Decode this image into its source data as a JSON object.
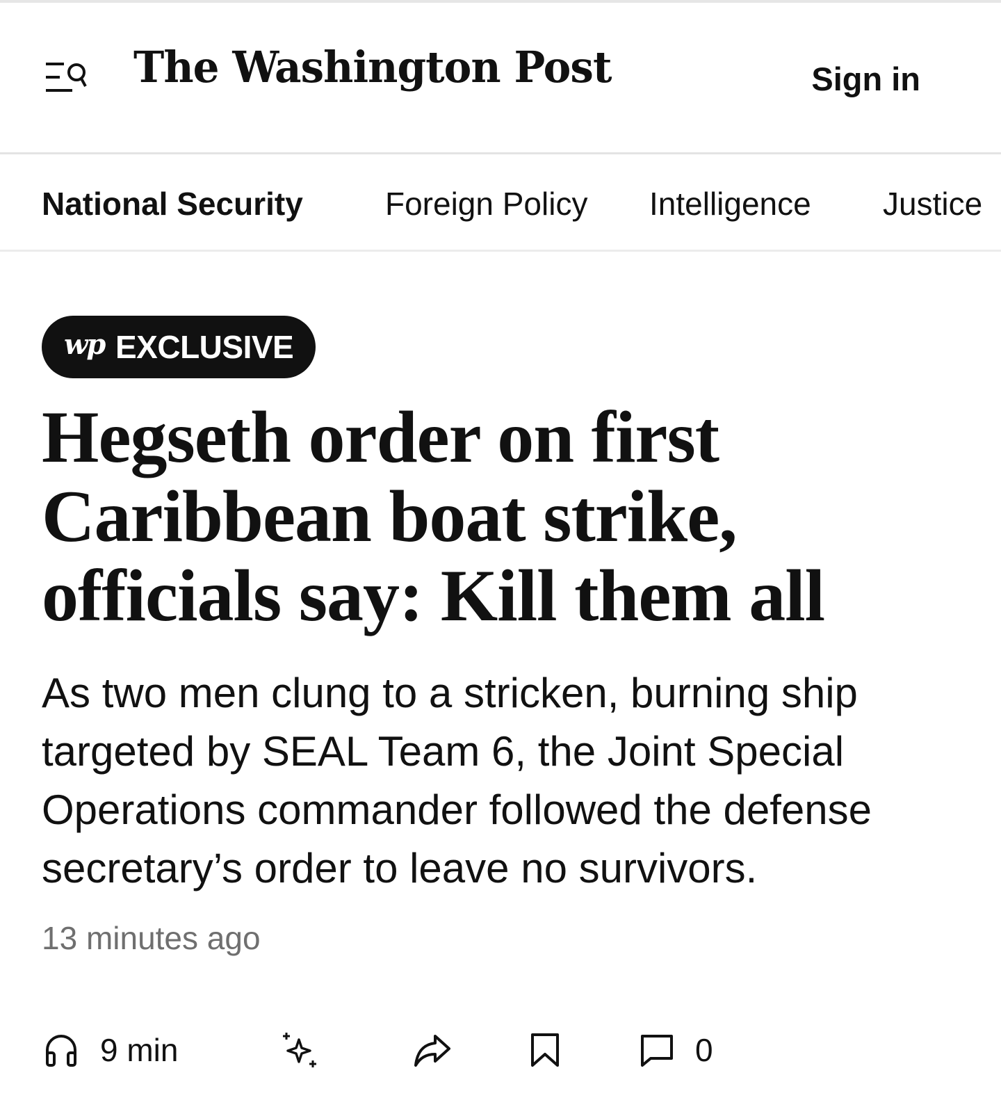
{
  "header": {
    "logo_text": "The Washington Post",
    "sign_in_label": "Sign in",
    "menu_icon": "menu-search-icon"
  },
  "section_nav": {
    "items": [
      {
        "label": "National Security",
        "active": true
      },
      {
        "label": "Foreign Policy",
        "active": false
      },
      {
        "label": "Intelligence",
        "active": false
      },
      {
        "label": "Justice",
        "active": false
      }
    ]
  },
  "article": {
    "badge": {
      "logo": "wp",
      "label": "EXCLUSIVE"
    },
    "headline": "Hegseth order on first Caribbean boat strike, officials say: Kill them all",
    "dek": "As two men clung to a stricken, burning ship targeted by SEAL Team 6, the Joint Special Operations commander followed the defense secretary’s order to leave no survivors.",
    "timestamp": "13 minutes ago"
  },
  "actions": {
    "listen_label": "9 min",
    "comments_count": "0",
    "icons": [
      "headphones-icon",
      "sparkle-icon",
      "share-icon",
      "bookmark-icon",
      "comment-icon"
    ]
  },
  "colors": {
    "text": "#111111",
    "muted": "#6f6f6f",
    "divider": "#e3e3e3",
    "badge_bg": "#111111",
    "badge_text": "#ffffff"
  }
}
